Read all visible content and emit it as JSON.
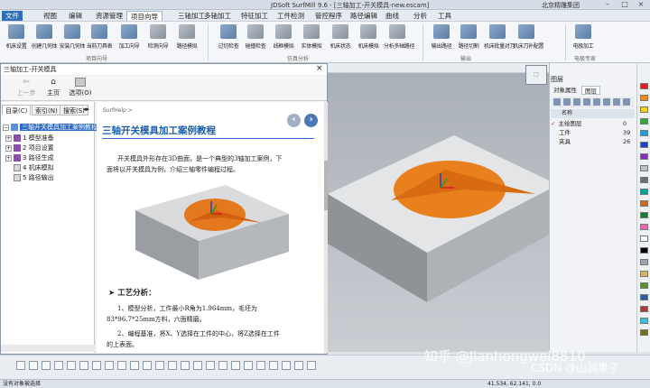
{
  "window": {
    "title": "JDSoft SurfMill 9.6 - [三轴加工-开关模具-new.escam]",
    "right_info": "北京精雕集团"
  },
  "menu": {
    "items": [
      "文件",
      "视图",
      "编辑",
      "资源管理",
      "项目向导",
      "三轴加工",
      "多轴加工",
      "特征加工",
      "工件检测",
      "管控程序",
      "路径编辑",
      "曲线",
      "分析",
      "工具"
    ],
    "active": "项目向导"
  },
  "ribbon": {
    "buttons": [
      "机床设置",
      "创建几何体",
      "安装几何体",
      "当前刀具表",
      "加工向导",
      "检测向导",
      "路径模拟",
      "过切检查",
      "碰撞检查",
      "线框模拟",
      "实体模拟",
      "机床状态",
      "机床模拟",
      "分析多轴路径",
      "输出路径",
      "路径切割",
      "机床批量对刀",
      "机床刀补配置",
      "电极加工"
    ],
    "groups": [
      "项目向导",
      "仿真分析",
      "输出",
      "电极专家"
    ]
  },
  "help": {
    "title": "三轴加工-开关模具",
    "toolbar": [
      "上一步",
      "主页",
      "选项(O)"
    ],
    "left_tabs": [
      "目录(C)",
      "索引(N)",
      "搜索(S)"
    ],
    "tree": [
      "三轴开关模具加工案例教程",
      "1 模型准备",
      "2 项目设置",
      "3 路径生成",
      "4 机床模拟",
      "5 路径输出"
    ],
    "breadcrumb": "SurfHelp >",
    "heading": "三轴开关模具加工案例教程",
    "intro_line1": "开关模具外形存在3D曲面，是一个典型的3轴加工案例，下",
    "intro_line2": "面将以开关模具为例，介绍三轴零件编程过程。",
    "section": "➤ 工艺分析：",
    "item1_line1": "1、模型分析，工件最小R角为1.964mm，毛坯为",
    "item1_line2": "83*96.7*25mm方料，六面精磨。",
    "item2_line1": "2、编程基准，将X、Y选择在工件的中心，将Z选择在工件",
    "item2_line2": "的上表面。"
  },
  "objects_panel": {
    "title": "图层",
    "tabs": [
      "对象属性",
      "图层"
    ],
    "columns": [
      "名称"
    ],
    "rows": [
      {
        "name": "主绘图层",
        "count": "0"
      },
      {
        "name": "工件",
        "count": "39"
      },
      {
        "name": "夹具",
        "count": "26"
      }
    ]
  },
  "palette": [
    "#e02020",
    "#f08a1c",
    "#f2d21d",
    "#3aa53a",
    "#1e9fd8",
    "#2040c0",
    "#8a2fb5",
    "#c0c0c0",
    "#6e6e6e",
    "#00a09a",
    "#c76b1e",
    "#1a7a2a",
    "#e86bb0",
    "#ffffff",
    "#000000",
    "#9aa5b1",
    "#d6b26a",
    "#5e8e2e",
    "#2e5e9e",
    "#a83a3a",
    "#3ac0d0",
    "#707020"
  ],
  "status": {
    "left": "没有对象被选择",
    "coords": "41.534, 62.141, 0.0"
  },
  "watermarks": {
    "zhihu": "知乎 @Jianhongwei8810",
    "csdn": "CSDN @山涧果子"
  }
}
